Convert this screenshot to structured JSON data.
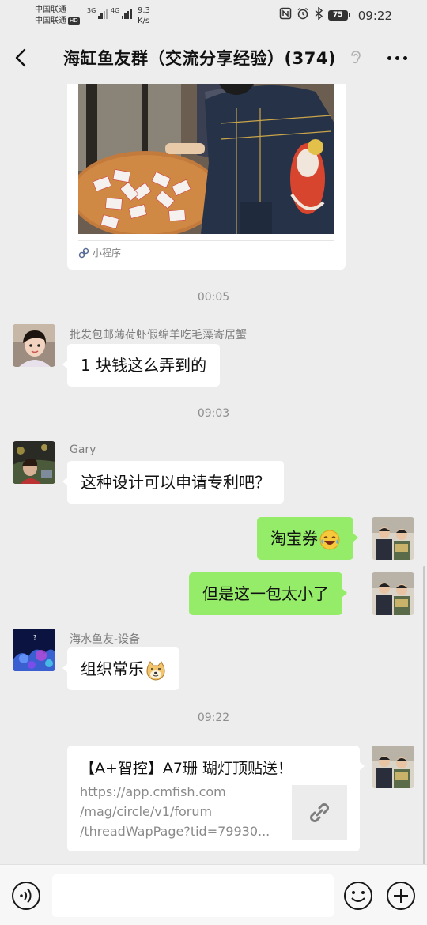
{
  "status_bar": {
    "carrier1": "中国联通",
    "carrier2": "中国联通",
    "hd_badge": "HD",
    "net1": "3G",
    "net2": "4G",
    "speed_value": "9.3",
    "speed_unit": "K/s",
    "battery": "75",
    "time": "09:22",
    "icons": [
      "nfc-icon",
      "alarm-icon",
      "bluetooth-icon"
    ]
  },
  "header": {
    "title": "海缸鱼友群（交流分享经验）(374)",
    "icons": [
      "back-icon",
      "ear-icon",
      "more-icon"
    ]
  },
  "messages": {
    "mini_program_label": "小程序",
    "t1": "00:05",
    "m1_sender": "批发包邮薄荷虾假绵羊吃毛藻寄居蟹",
    "m1_text": "1 块钱这么弄到的",
    "t2": "09:03",
    "m2_sender": "Gary",
    "m2_text": "这种设计可以申请专利吧？",
    "m3_text": "淘宝券",
    "m4_text": "但是这一包太小了",
    "m5_sender": "海水鱼友-设备",
    "m5_text": "组织常乐",
    "t3": "09:22",
    "link": {
      "title": "【A+智控】A7珊 瑚灯顶贴送！",
      "url_line1": "https://app.cmfish.com",
      "url_line2": "/mag/circle/v1/forum",
      "url_line3": "/threadWapPage?tid=79930..."
    }
  },
  "input_bar": {
    "placeholder": "",
    "icons": [
      "voice-icon",
      "emoji-icon",
      "plus-icon"
    ]
  },
  "colors": {
    "background": "#ededed",
    "out_bubble": "#95ec69",
    "in_bubble": "#ffffff"
  }
}
